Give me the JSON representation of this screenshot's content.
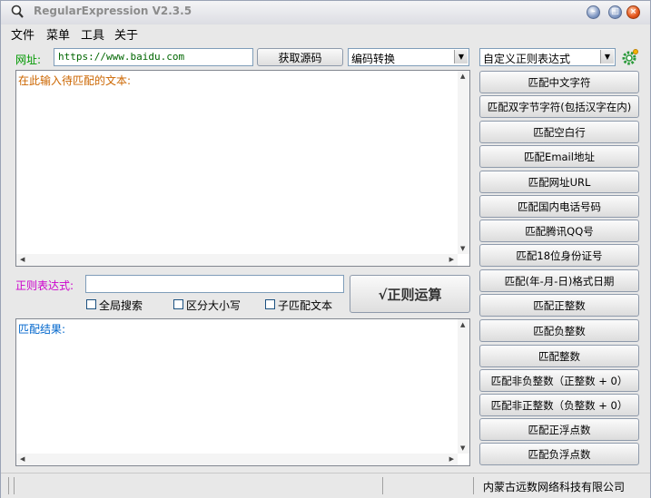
{
  "window": {
    "title": "RegularExpression V2.3.5",
    "icon": "magnifier-icon"
  },
  "menu": [
    "文件",
    "菜单",
    "工具",
    "关于"
  ],
  "url": {
    "label": "网址:",
    "value": "https://www.baidu.com",
    "fetch_button": "获取源码",
    "encoding_select": "编码转换"
  },
  "input_area": {
    "placeholder_text": "在此输入待匹配的文本:"
  },
  "regex": {
    "label": "正则表达式:",
    "value": "",
    "run_button": "√正则运算",
    "options": [
      "全局搜索",
      "区分大小写",
      "子匹配文本"
    ]
  },
  "result_area": {
    "label": "匹配结果:"
  },
  "right_panel": {
    "custom_select": "自定义正则表达式",
    "settings_icon": "gear-icon",
    "buttons": [
      "匹配中文字符",
      "匹配双字节字符(包括汉字在内)",
      "匹配空白行",
      "匹配Email地址",
      "匹配网址URL",
      "匹配国内电话号码",
      "匹配腾讯QQ号",
      "匹配18位身份证号",
      "匹配(年-月-日)格式日期",
      "匹配正整数",
      "匹配负整数",
      "匹配整数",
      "匹配非负整数（正整数 + 0）",
      "匹配非正整数（负整数 + 0）",
      "匹配正浮点数",
      "匹配负浮点数"
    ]
  },
  "status": {
    "company": "内蒙古远数网络科技有限公司"
  },
  "colors": {
    "url_label": "#009900",
    "regex_label": "#cc00cc",
    "input_hint": "#cc6600",
    "result_label": "#0066cc"
  }
}
